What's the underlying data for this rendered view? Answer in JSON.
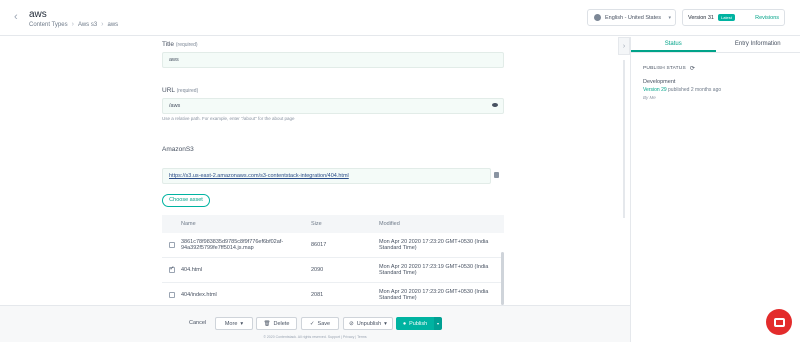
{
  "header": {
    "title": "aws",
    "breadcrumb": [
      "Content Types",
      "Aws s3",
      "aws"
    ],
    "locale": "English - United States",
    "version_label": "Version 31",
    "version_badge": "Latest",
    "revisions_label": "Revisions"
  },
  "form": {
    "title_label": "Title",
    "title_required": "(required)",
    "title_value": "aws",
    "url_label": "URL",
    "url_required": "(required)",
    "url_value": "/aws",
    "url_hint": "Use a relative path. For example, enter \"/about\" for the about page",
    "s3_label": "AmazonS3",
    "s3_url": "https://s3.us-east-2.amazonaws.com/s3-contentstack-integration/404.html",
    "choose_asset": "Choose asset"
  },
  "asset_table": {
    "columns": [
      "Name",
      "Size",
      "Modified"
    ],
    "rows": [
      {
        "name": "3861c78f983835d9785c8f9f776ef6bf02af-94a392f5799fe7ff5014.js.map",
        "size": "86017",
        "modified": "Mon Apr 20 2020 17:23:20 GMT+0530 (India Standard Time)",
        "checked": false
      },
      {
        "name": "404.html",
        "size": "2090",
        "modified": "Mon Apr 20 2020 17:23:19 GMT+0530 (India Standard Time)",
        "checked": true
      },
      {
        "name": "404/index.html",
        "size": "2081",
        "modified": "Mon Apr 20 2020 17:23:20 GMT+0530 (India Standard Time)",
        "checked": false
      }
    ]
  },
  "footer": {
    "cancel": "Cancel",
    "more": "More",
    "delete": "Delete",
    "save": "Save",
    "unpublish": "Unpublish",
    "publish": "Publish",
    "copyright": "© 2020 Contentstack. All rights reserved. Support | Privacy | Terms"
  },
  "sidebar": {
    "tabs": [
      "Status",
      "Entry Information"
    ],
    "publish_status": "PUBLISH STATUS",
    "environment": "Development",
    "version_text": "Version 29",
    "published_text": "published 2 months ago",
    "by_text": "By Me"
  },
  "colors": {
    "accent": "#00b3a1",
    "chat": "#e32c2c"
  }
}
